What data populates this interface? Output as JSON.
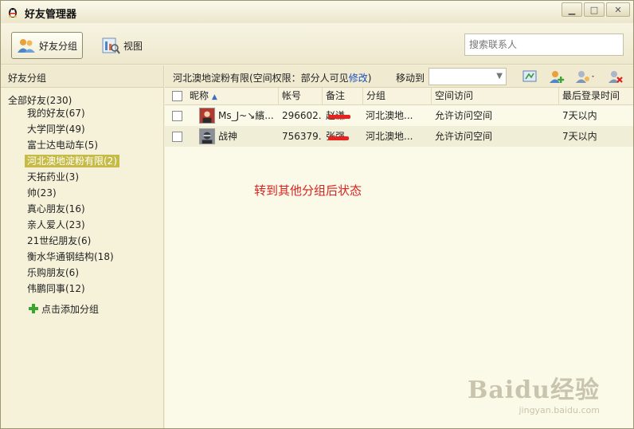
{
  "window": {
    "title": "好友管理器",
    "buttons": [
      "minimize",
      "maximize",
      "close"
    ]
  },
  "toolbar": {
    "friend_group_label": "好友分组",
    "view_label": "视图",
    "search_placeholder": "搜索联系人"
  },
  "sidebar": {
    "header": "好友分组",
    "root": "全部好友(230)",
    "items": [
      {
        "label": "我的好友(67)"
      },
      {
        "label": "大学同学(49)"
      },
      {
        "label": "富士达电动车(5)"
      },
      {
        "label": "河北澳地淀粉有限(2)",
        "selected": true
      },
      {
        "label": "天拓药业(3)"
      },
      {
        "label": "帅(23)"
      },
      {
        "label": "真心朋友(16)"
      },
      {
        "label": "亲人爱人(23)"
      },
      {
        "label": "21世纪朋友(6)"
      },
      {
        "label": "衡水华通钢结构(18)"
      },
      {
        "label": "乐购朋友(6)"
      },
      {
        "label": "伟鹏同事(12)"
      }
    ],
    "add_group": "点击添加分组"
  },
  "main": {
    "group_title": "河北澳地淀粉有限(空间权限：部分人可见",
    "modify_link": "修改",
    "close_paren": ")",
    "move_to": "移动到",
    "columns": [
      "昵称",
      "帐号",
      "备注",
      "分组",
      "空间访问",
      "最后登录时间"
    ],
    "rows": [
      {
        "nickname": "Ms_J~↘繽...",
        "account": "296602...",
        "note": "赵谦",
        "group": "河北澳地...",
        "space": "允许访问空间",
        "last_login": "7天以内"
      },
      {
        "nickname": "战神",
        "account": "756379...",
        "note": "张强",
        "group": "河北澳地...",
        "space": "允许访问空间",
        "last_login": "7天以内"
      }
    ],
    "annotation": "转到其他分组后状态"
  },
  "watermark": {
    "brand": "Baidu经验",
    "url": "jingyan.baidu.com"
  },
  "colors": {
    "selected_group": "#c6bb47",
    "link": "#1a4fbf",
    "annotation": "#d8231f"
  }
}
